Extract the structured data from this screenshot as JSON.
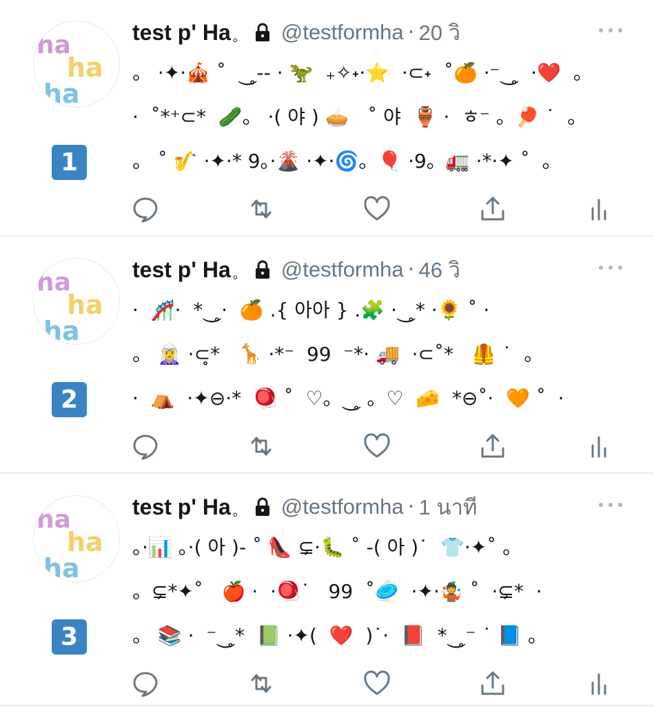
{
  "colors": {
    "text": "#14171a",
    "secondary": "#657786",
    "accent": "#3b84c4",
    "divider": "#e6ecf0"
  },
  "avatar": {
    "letters": [
      "ha",
      "ha",
      "ha"
    ]
  },
  "tweets": [
    {
      "badge": "1",
      "display_name": "test p' Ha",
      "name_suffix": "。",
      "handle": "@testformha",
      "separator": "·",
      "time": "20 วิ",
      "lines": [
        "。 ·✦·🎪 ˚  ⏝̥-- · 🦖  ₊✧˖·⭐️  ·⊂˖  ˚🍊 ·⁻⏝̥  ·❤️  。",
        "·  ˚*⁺⊂*  🥒。 ·( 야 ) 🥧   ˚ 야  🏺 ·  ㅎ⁻ 。🏓 ˙  。",
        "。 ˚ 🎷 ·✦·* 9。·🌋 ·✦·🌀。🎈 ·9。🚛 ·*·✦ ˚  。"
      ]
    },
    {
      "badge": "2",
      "display_name": "test p' Ha",
      "name_suffix": "。",
      "handle": "@testformha",
      "separator": "·",
      "time": "46 วิ",
      "lines": [
        "·  🎢·  *⏝̥·  🍊 .{ 아아 } .🧩 ·⏝̥* ·🌻 ˚ ·",
        "。 🧝‍♀️ ·⊂̥*   🦒 ·*⁻  99  ⁻*· 🚚  ·⊂˚*   🦺 ˙  。",
        "·  ⛺️  ·✦⊖·*  🪀 ˚  ♡。⏝̥ 。♡  🧀  *⊖˚·  🧡 ˚  ·"
      ]
    },
    {
      "badge": "3",
      "display_name": "test p' Ha",
      "name_suffix": "。",
      "handle": "@testformha",
      "separator": "·",
      "time": "1 นาที",
      "lines": [
        "。·📊 。·( 아 )- ˚ 👠 ⊊·🐛 ˚ -( 아 )˙  👕·✦˚ 。",
        "。⊊*✦˚   🍎 ·  ·🪀˙   99  ˚🥏  ·✦·🤹 ˚  ·⊊*  ·",
        "。 📚 ·  ⁻⏝̥*  📗 ·✦(  ❤️  )˙·  📕  *⏝̥⁻ ˙ 📘 。"
      ]
    }
  ],
  "actions": [
    "reply-icon",
    "retweet-icon",
    "like-icon",
    "share-icon",
    "analytics-icon"
  ]
}
